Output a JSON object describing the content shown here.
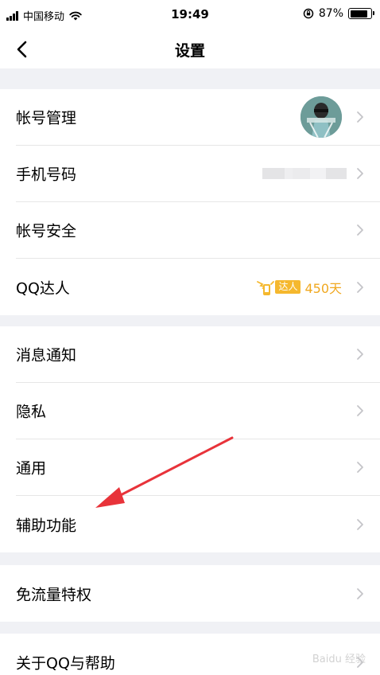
{
  "status_bar": {
    "carrier": "中国移动",
    "time": "19:49",
    "battery": "87%",
    "battery_level": 0.87
  },
  "nav": {
    "title": "设置"
  },
  "groups": [
    {
      "rows": [
        {
          "label": "帐号管理"
        },
        {
          "label": "手机号码"
        },
        {
          "label": "帐号安全"
        },
        {
          "label": "QQ达人",
          "badge": "达人",
          "days": "450天"
        }
      ]
    },
    {
      "rows": [
        {
          "label": "消息通知"
        },
        {
          "label": "隐私"
        },
        {
          "label": "通用"
        },
        {
          "label": "辅助功能"
        }
      ]
    },
    {
      "rows": [
        {
          "label": "免流量特权"
        }
      ]
    },
    {
      "rows": [
        {
          "label": "关于QQ与帮助"
        }
      ]
    }
  ],
  "watermark": "Baidu 经验",
  "colors": {
    "accent": "#f5b82e",
    "days": "#f0a820",
    "arrow": "#e8333a",
    "background": "#f0f1f5"
  },
  "icons": [
    "back-arrow-icon",
    "chevron-right-icon",
    "signal-icon",
    "wifi-icon",
    "rotation-lock-icon",
    "battery-icon",
    "talent-wings-icon"
  ]
}
